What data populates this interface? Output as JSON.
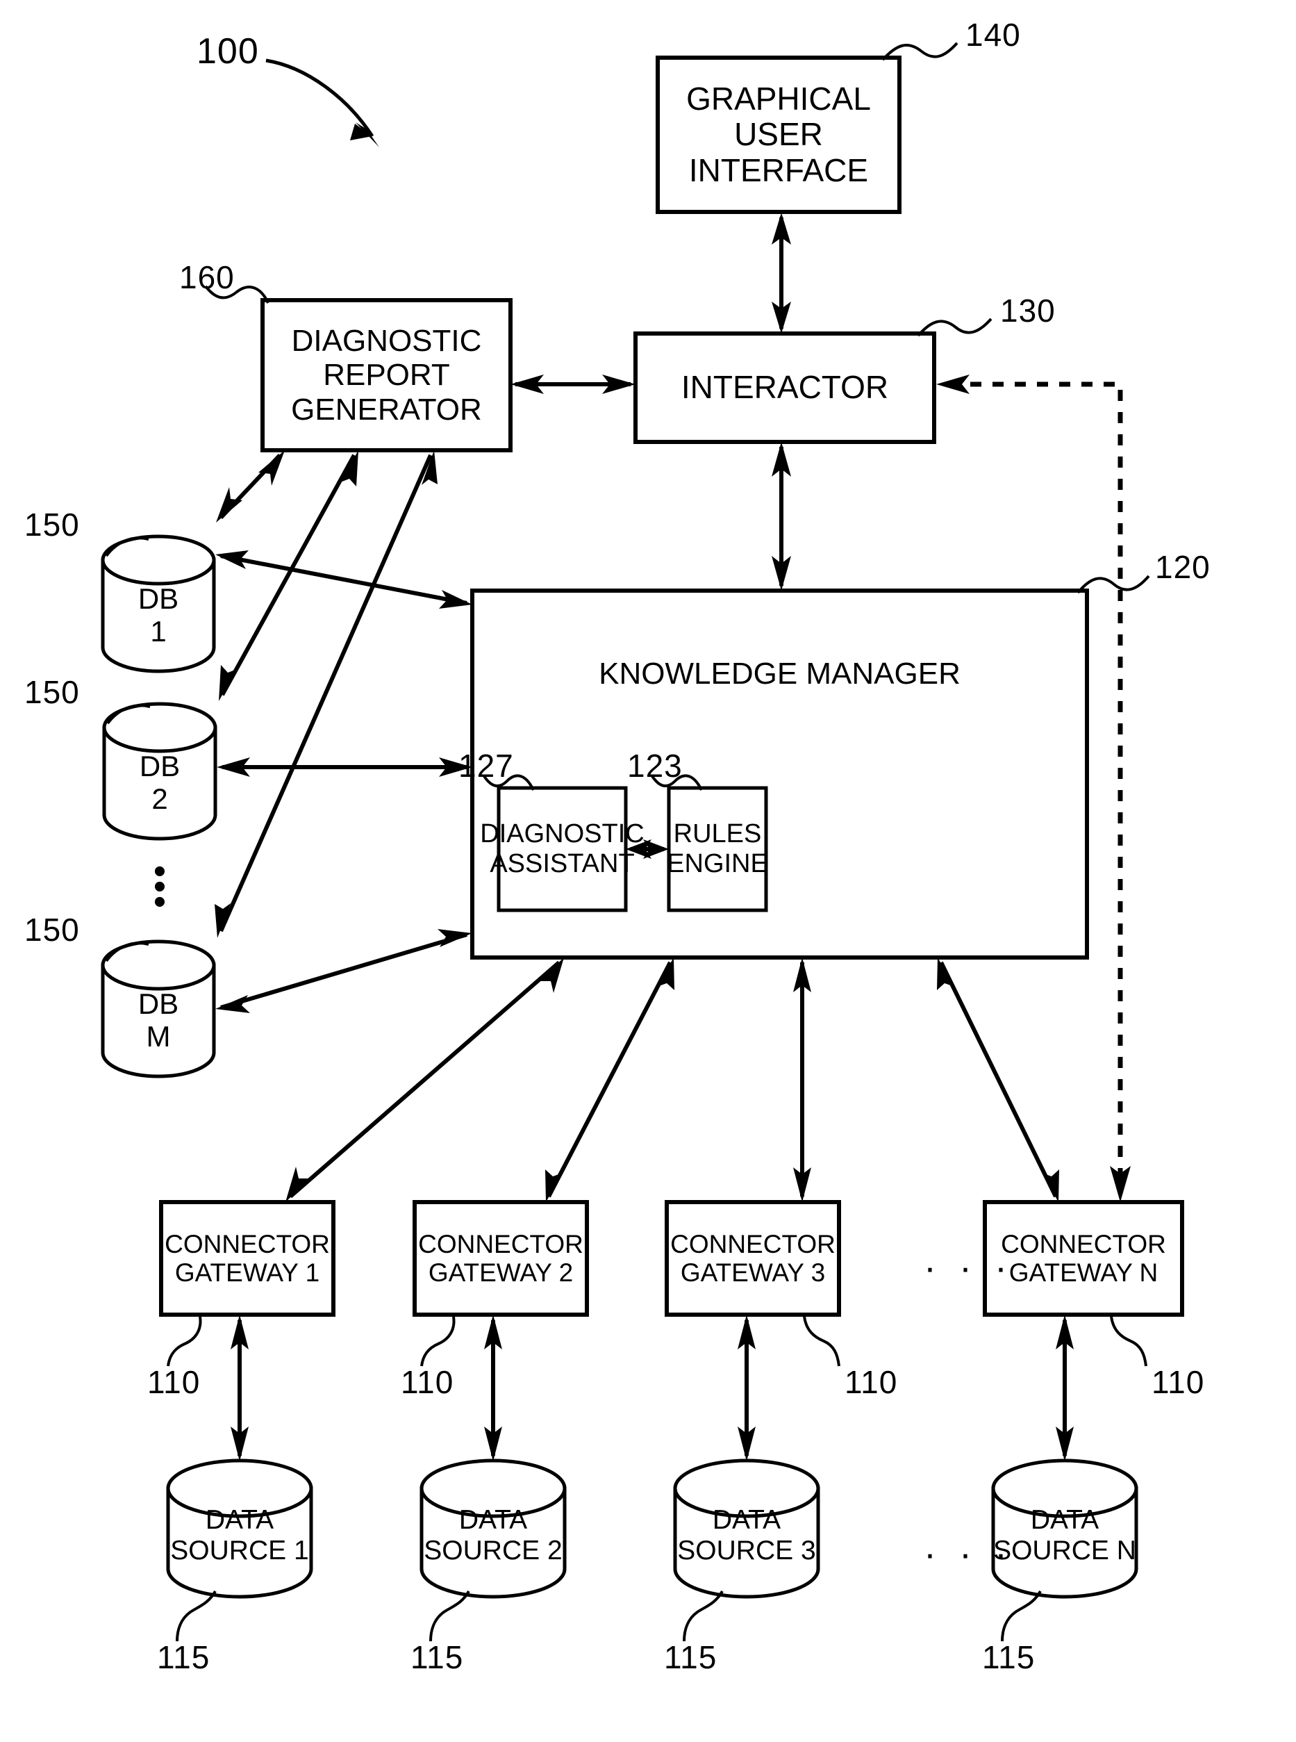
{
  "figure": {
    "reference_number": "100"
  },
  "blocks": {
    "gui": {
      "label": "GRAPHICAL\nUSER\nINTERFACE",
      "ref": "140"
    },
    "interactor": {
      "label": "INTERACTOR",
      "ref": "130"
    },
    "report_generator": {
      "label": "DIAGNOSTIC\nREPORT\nGENERATOR",
      "ref": "160"
    },
    "knowledge_manager": {
      "label": "KNOWLEDGE MANAGER",
      "ref": "120"
    },
    "diagnostic_assistant": {
      "label": "DIAGNOSTIC\nASSISTANT",
      "ref": "127"
    },
    "rules_engine": {
      "label": "RULES\nENGINE",
      "ref": "123"
    }
  },
  "databases": [
    {
      "label": "DB\n1",
      "ref": "150"
    },
    {
      "label": "DB\n2",
      "ref": "150"
    },
    {
      "label": "DB\nM",
      "ref": "150"
    }
  ],
  "db_continuation": "•\n•\n•",
  "gateways": [
    {
      "label": "CONNECTOR\nGATEWAY 1",
      "ref": "110"
    },
    {
      "label": "CONNECTOR\nGATEWAY 2",
      "ref": "110"
    },
    {
      "label": "CONNECTOR\nGATEWAY 3",
      "ref": "110"
    },
    {
      "label": "CONNECTOR\nGATEWAY N",
      "ref": "110"
    }
  ],
  "gateway_ellipsis": "· · ·",
  "data_sources": [
    {
      "label": "DATA\nSOURCE 1",
      "ref": "115"
    },
    {
      "label": "DATA\nSOURCE 2",
      "ref": "115"
    },
    {
      "label": "DATA\nSOURCE 3",
      "ref": "115"
    },
    {
      "label": "DATA\nSOURCE N",
      "ref": "115"
    }
  ],
  "data_source_ellipsis": "· · ·",
  "colors": {
    "stroke": "#000000",
    "background": "#ffffff",
    "text": "#000000"
  }
}
